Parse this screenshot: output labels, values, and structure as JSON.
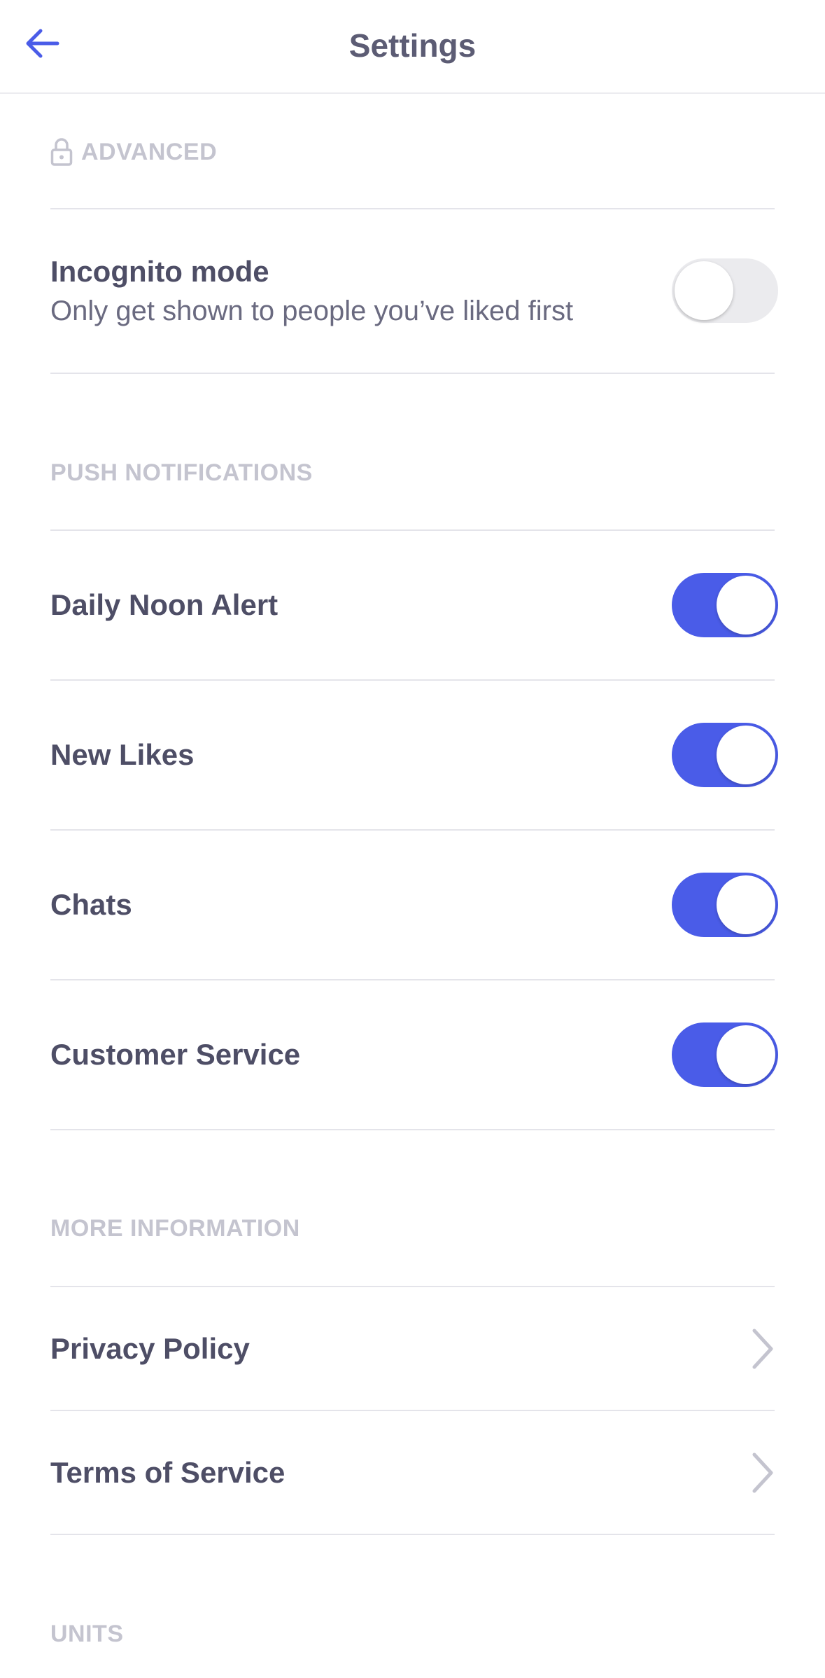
{
  "header": {
    "title": "Settings",
    "back_icon": "arrow-left-icon"
  },
  "colors": {
    "accent": "#4a5ce8",
    "text_primary": "#4e4e66",
    "section_label": "#c4c4cf",
    "divider": "#e4e4ea",
    "toggle_off": "#ebebee"
  },
  "advanced": {
    "label": "ADVANCED",
    "lock_icon": "lock-icon",
    "incognito": {
      "title": "Incognito mode",
      "subtitle": "Only get shown to people you’ve liked first",
      "enabled": false
    }
  },
  "push_notifications": {
    "label": "PUSH NOTIFICATIONS",
    "items": [
      {
        "title": "Daily Noon Alert",
        "enabled": true
      },
      {
        "title": "New Likes",
        "enabled": true
      },
      {
        "title": "Chats",
        "enabled": true
      },
      {
        "title": "Customer Service",
        "enabled": true
      }
    ]
  },
  "more_information": {
    "label": "MORE INFORMATION",
    "items": [
      {
        "title": "Privacy Policy",
        "icon": "chevron-right-icon"
      },
      {
        "title": "Terms of Service",
        "icon": "chevron-right-icon"
      }
    ]
  },
  "units": {
    "label": "UNITS"
  }
}
